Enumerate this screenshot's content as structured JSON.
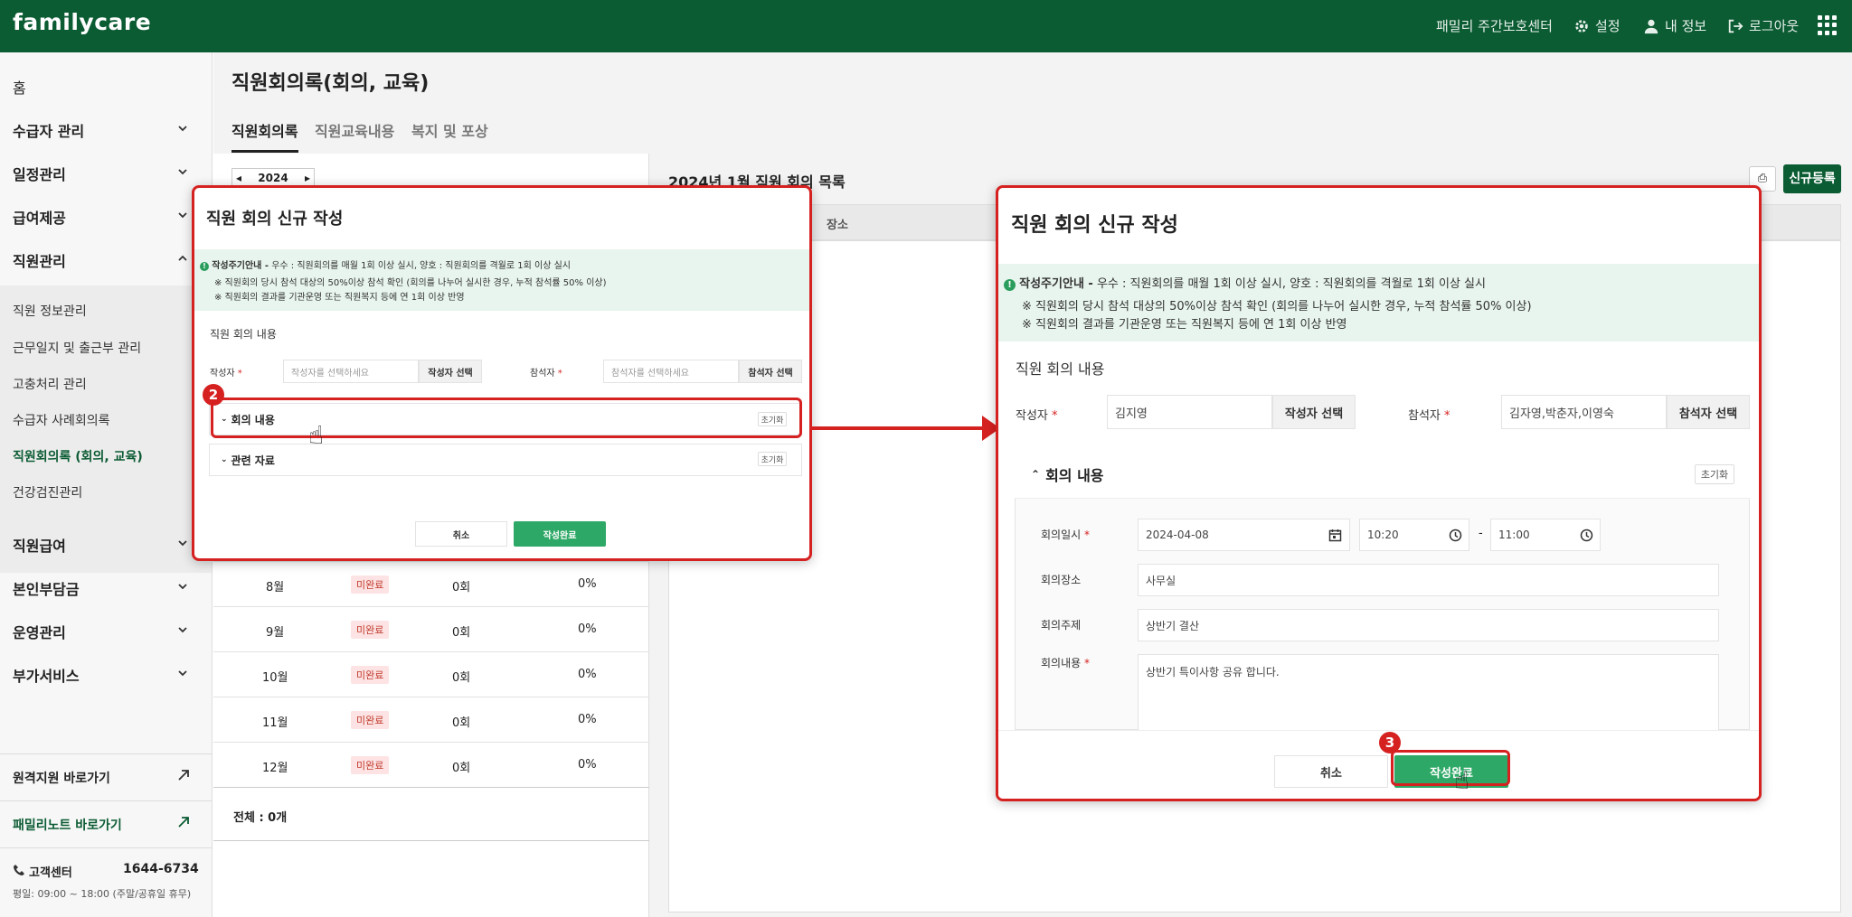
{
  "header": {
    "logo": "familycare",
    "center_name": "패밀리 주간보호센터",
    "settings": "설정",
    "my_info": "내 정보",
    "logout": "로그아웃"
  },
  "sidebar": {
    "home": "홈",
    "items": [
      {
        "label": "수급자 관리"
      },
      {
        "label": "일정관리"
      },
      {
        "label": "급여제공"
      },
      {
        "label": "직원관리"
      }
    ],
    "sub_items": [
      {
        "label": "직원 정보관리"
      },
      {
        "label": "근무일지 및 출근부 관리"
      },
      {
        "label": "고충처리 관리"
      },
      {
        "label": "수급자 사례회의록"
      },
      {
        "label": "직원회의록 (회의, 교육)"
      },
      {
        "label": "건강검진관리"
      }
    ],
    "items_after": [
      {
        "label": "직원급여"
      },
      {
        "label": "본인부담금"
      },
      {
        "label": "운영관리"
      },
      {
        "label": "부가서비스"
      }
    ],
    "remote_support": "원격지원 바로가기",
    "family_note": "패밀리노트 바로가기",
    "support_center": "고객센터",
    "phone": "1644-6734",
    "hours": "평일: 09:00 ~ 18:00 (주말/공휴일 휴무)"
  },
  "page": {
    "title": "직원회의록(회의, 교육)",
    "tabs": [
      "직원회의록",
      "직원교육내용",
      "복지 및 포상"
    ],
    "year": "2024",
    "list_title": "2024년 1월 직원 회의 목록",
    "col_place": "장소",
    "new_button": "신규등록",
    "total": "전체 : 0개",
    "months": [
      {
        "month": "8월",
        "status": "미완료",
        "count": "0회",
        "rate": "0%"
      },
      {
        "month": "9월",
        "status": "미완료",
        "count": "0회",
        "rate": "0%"
      },
      {
        "month": "10월",
        "status": "미완료",
        "count": "0회",
        "rate": "0%"
      },
      {
        "month": "11월",
        "status": "미완료",
        "count": "0회",
        "rate": "0%"
      },
      {
        "month": "12월",
        "status": "미완료",
        "count": "0회",
        "rate": "0%"
      }
    ]
  },
  "dialog": {
    "title": "직원 회의 신규 작성",
    "notice_head": "작성주기안내 -",
    "notice_main": "우수 : 직원회의를 매월 1회 이상 실시, 양호 : 직원회의를 격월로 1회 이상 실시",
    "notice_line2": "※ 직원회의 당시 참석 대상의 50%이상 참석 확인 (회의를 나누어 실시한 경우, 누적 참석률 50% 이상)",
    "notice_line3": "※ 직원회의 결과를 기관운영 또는 직원복지 등에 연 1회 이상 반영",
    "section_label": "직원 회의 내용",
    "writer_label": "작성자",
    "writer_placeholder": "작성자를 선택하세요",
    "writer_btn": "작성자 선택",
    "attendee_label": "참석자",
    "attendee_placeholder": "참석자를 선택하세요",
    "attendee_btn": "참석자 선택",
    "meeting_content": "회의 내용",
    "related": "관련 자료",
    "reset": "초기화",
    "cancel": "취소",
    "submit": "작성완료"
  },
  "dialog_filled": {
    "writer": "김지영",
    "attendees": "김자영,박춘자,이영숙",
    "date_label": "회의일시",
    "date": "2024-04-08",
    "time_start": "10:20",
    "dash": "-",
    "time_end": "11:00",
    "place_label": "회의장소",
    "place": "사무실",
    "topic_label": "회의주제",
    "topic": "상반기 결산",
    "content_label": "회의내용",
    "content": "상반기 특이사항 공유 합니다."
  },
  "steps": [
    "2",
    "3"
  ],
  "colors": {
    "brand": "#0b5b33",
    "accent": "#2ea866",
    "highlight": "#d62121"
  }
}
